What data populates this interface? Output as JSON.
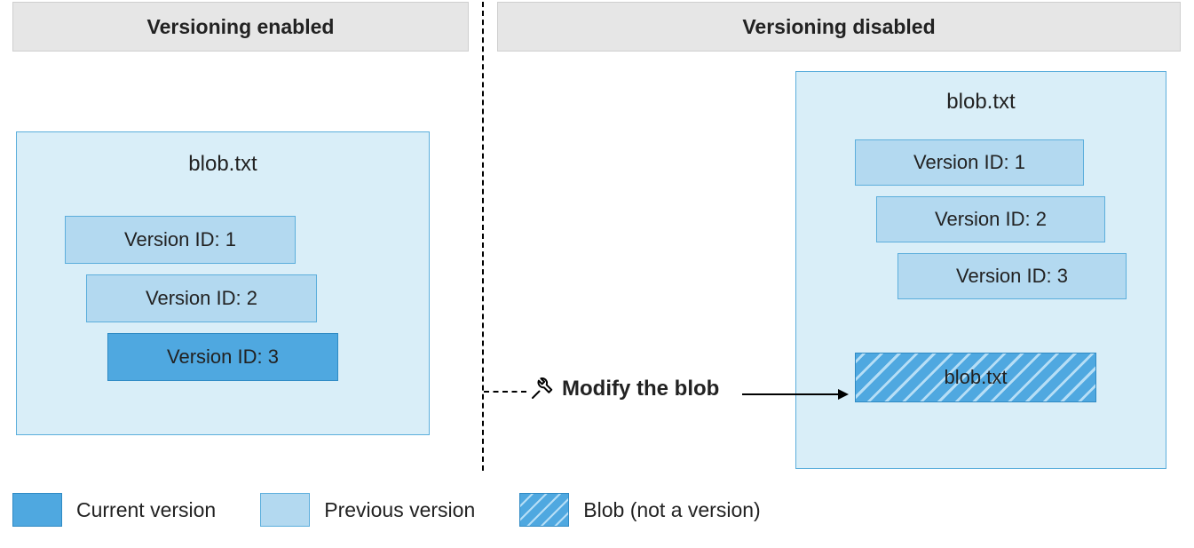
{
  "headers": {
    "left": "Versioning enabled",
    "right": "Versioning disabled"
  },
  "left": {
    "blob_name": "blob.txt",
    "versions": {
      "v1": "Version ID: 1",
      "v2": "Version ID: 2",
      "v3": "Version ID: 3"
    }
  },
  "right": {
    "blob_name": "blob.txt",
    "versions": {
      "v1": "Version ID: 1",
      "v2": "Version ID: 2",
      "v3": "Version ID: 3"
    },
    "modified_blob_label": "blob.txt"
  },
  "action_label": "Modify the blob",
  "legend": {
    "current": "Current version",
    "previous": "Previous version",
    "not_version": "Blob (not a version)"
  }
}
